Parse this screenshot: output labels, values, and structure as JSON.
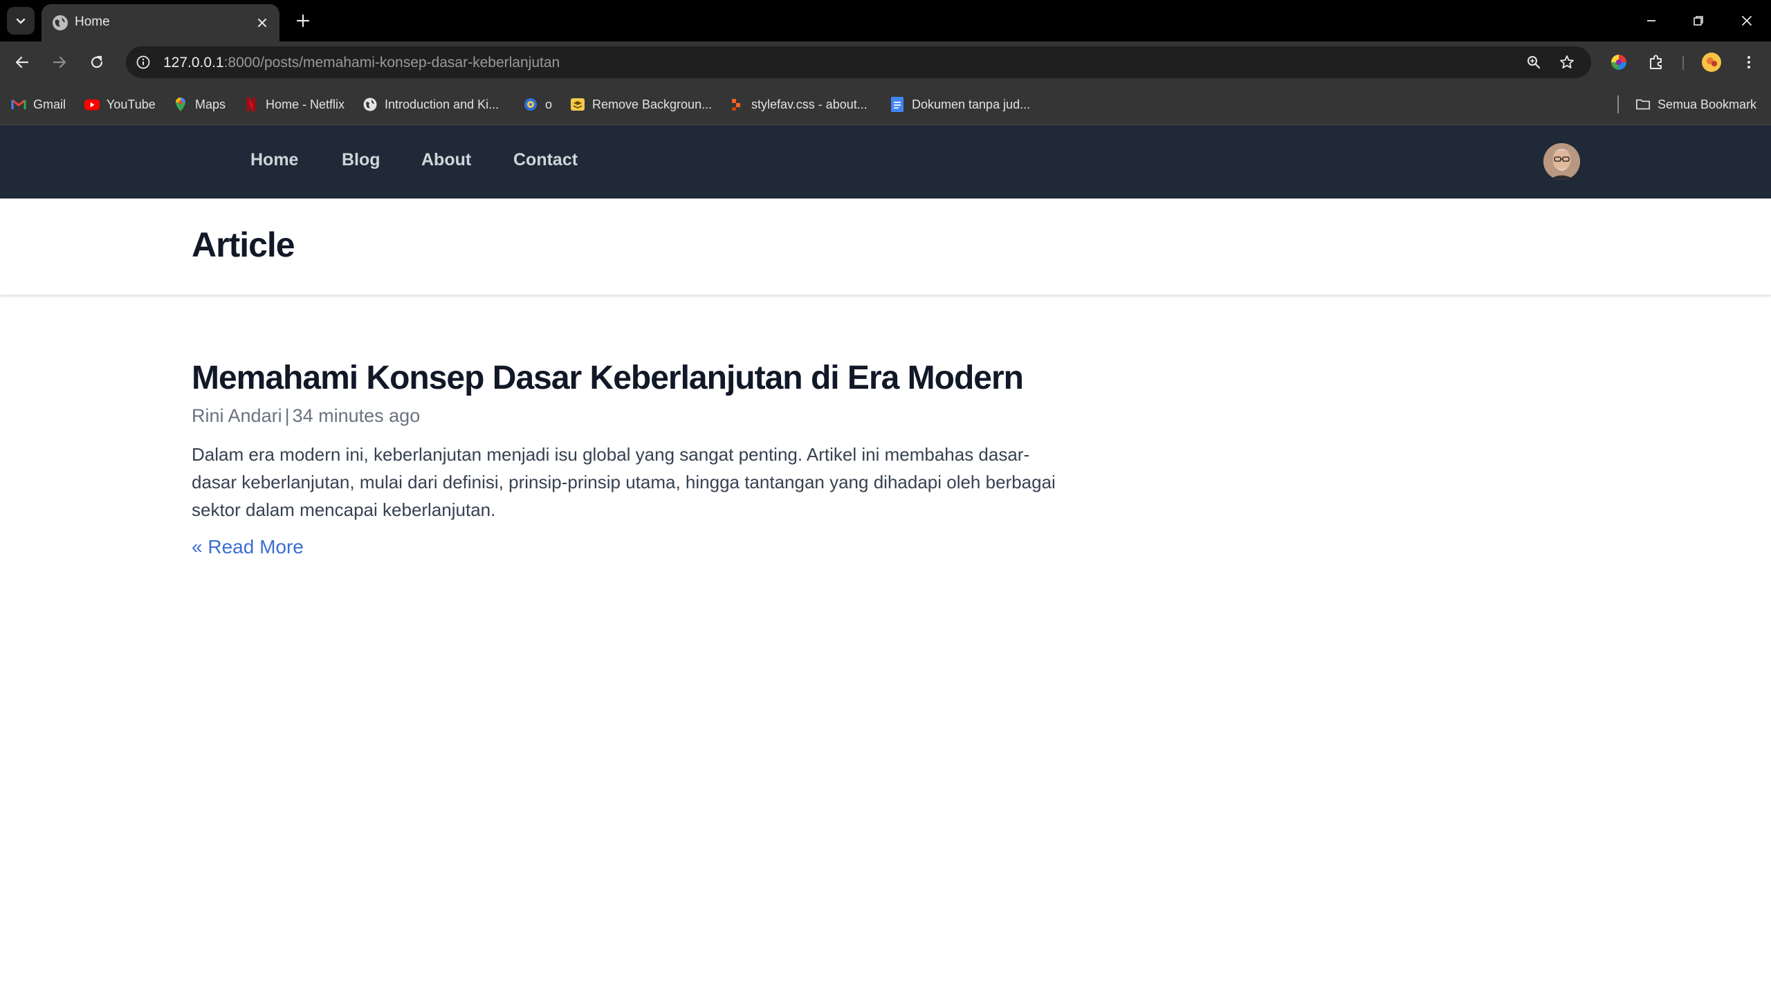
{
  "browser": {
    "tab": {
      "title": "Home",
      "favicon": "globe-icon"
    },
    "url": {
      "host": "127.0.0.1",
      "path": ":8000/posts/memahami-konsep-dasar-keberlanjutan"
    },
    "bookmarks": [
      {
        "label": "Gmail",
        "icon": "gmail-icon"
      },
      {
        "label": "YouTube",
        "icon": "youtube-icon"
      },
      {
        "label": "Maps",
        "icon": "maps-icon"
      },
      {
        "label": "Home - Netflix",
        "icon": "netflix-icon"
      },
      {
        "label": "Introduction and Ki...",
        "icon": "globe-icon"
      },
      {
        "label": "o",
        "icon": "site-icon"
      },
      {
        "label": "Remove Backgroun...",
        "icon": "remove-bg-icon"
      },
      {
        "label": "stylefav.css - about...",
        "icon": "code-icon"
      },
      {
        "label": "Dokumen tanpa jud...",
        "icon": "docs-icon"
      }
    ],
    "all_bookmarks": "Semua Bookmark"
  },
  "site": {
    "nav": [
      {
        "label": "Home"
      },
      {
        "label": "Blog"
      },
      {
        "label": "About"
      },
      {
        "label": "Contact"
      }
    ],
    "colors": {
      "nav_bg": "#1f2937",
      "link": "#3b6fd4"
    }
  },
  "header": {
    "title": "Article"
  },
  "article": {
    "title": "Memahami Konsep Dasar Keberlanjutan di Era Modern",
    "author": "Rini Andari",
    "separator": "|",
    "time": "34 minutes ago",
    "excerpt": "Dalam era modern ini, keberlanjutan menjadi isu global yang sangat penting. Artikel ini membahas dasar-dasar keberlanjutan, mulai dari definisi, prinsip-prinsip utama, hingga tantangan yang dihadapi oleh berbagai sektor dalam mencapai keberlanjutan.",
    "read_more": "« Read More"
  }
}
